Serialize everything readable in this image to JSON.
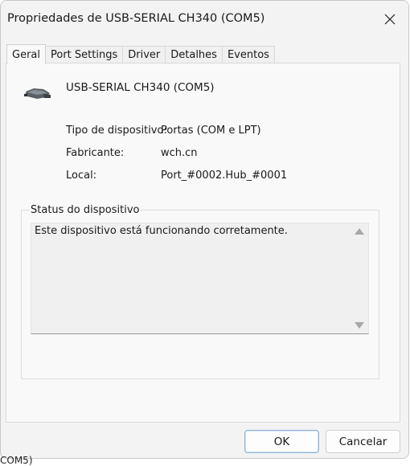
{
  "window": {
    "title": "Propriedades de USB-SERIAL CH340 (COM5)"
  },
  "tabs": [
    {
      "label": "Geral",
      "active": true
    },
    {
      "label": "Port Settings",
      "active": false
    },
    {
      "label": "Driver",
      "active": false
    },
    {
      "label": "Detalhes",
      "active": false
    },
    {
      "label": "Eventos",
      "active": false
    }
  ],
  "device": {
    "name": "USB-SERIAL CH340 (COM5)",
    "icon": "serial-port-connector-icon",
    "properties": [
      {
        "label": "Tipo de dispositivo:",
        "value": "Portas (COM e LPT)"
      },
      {
        "label": "Fabricante:",
        "value": "wch.cn"
      },
      {
        "label": "Local:",
        "value": "Port_#0002.Hub_#0001"
      }
    ]
  },
  "status": {
    "legend": "Status do dispositivo",
    "text": "Este dispositivo está funcionando corretamente."
  },
  "buttons": {
    "ok": "OK",
    "cancel": "Cancelar"
  },
  "background": {
    "peek_text": "COM5)"
  },
  "colors": {
    "window_bg": "#f3f3f3",
    "panel_bg": "#f9f9f9",
    "accent_border": "#8fb4d9"
  }
}
